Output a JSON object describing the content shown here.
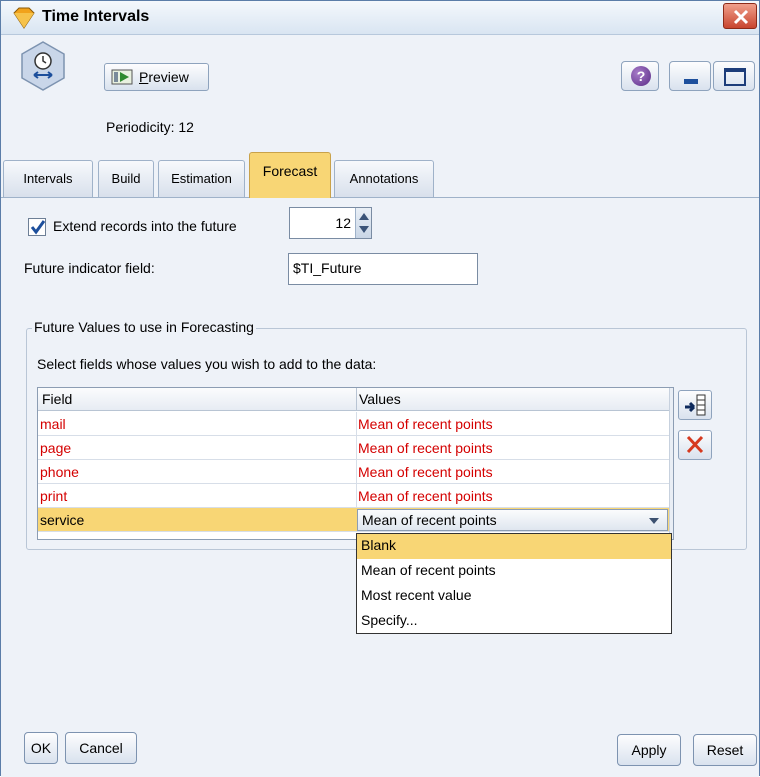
{
  "window": {
    "title": "Time Intervals"
  },
  "header": {
    "preview_label": "Preview",
    "periodicity_text": "Periodicity: 12"
  },
  "tabs": [
    {
      "label": "Intervals",
      "active": false
    },
    {
      "label": "Build",
      "active": false
    },
    {
      "label": "Estimation",
      "active": false
    },
    {
      "label": "Forecast",
      "active": true
    },
    {
      "label": "Annotations",
      "active": false
    }
  ],
  "forecast": {
    "extend_checked": true,
    "extend_label": "Extend records into the future",
    "extend_value": "12",
    "future_indicator_label": "Future indicator field:",
    "future_indicator_value": "$TI_Future",
    "group_title": "Future Values to use in Forecasting",
    "select_label": "Select fields whose values you wish to add to the data:",
    "table": {
      "headers": [
        "Field",
        "Values"
      ],
      "rows": [
        {
          "field": "mail",
          "value": "Mean of recent points"
        },
        {
          "field": "page",
          "value": "Mean of recent points"
        },
        {
          "field": "phone",
          "value": "Mean of recent points"
        },
        {
          "field": "print",
          "value": "Mean of recent points"
        },
        {
          "field": "service",
          "value": "Mean of recent points"
        }
      ]
    },
    "dropdown_options": [
      "Blank",
      "Mean of recent points",
      "Most recent value",
      "Specify..."
    ],
    "dropdown_highlighted": "Blank"
  },
  "footer": {
    "ok_label": "OK",
    "cancel_label": "Cancel",
    "apply_label": "Apply",
    "reset_label": "Reset"
  },
  "colors": {
    "accent": "#f8d675",
    "error_text": "#d40000",
    "window_bg": "#eef2f8"
  }
}
